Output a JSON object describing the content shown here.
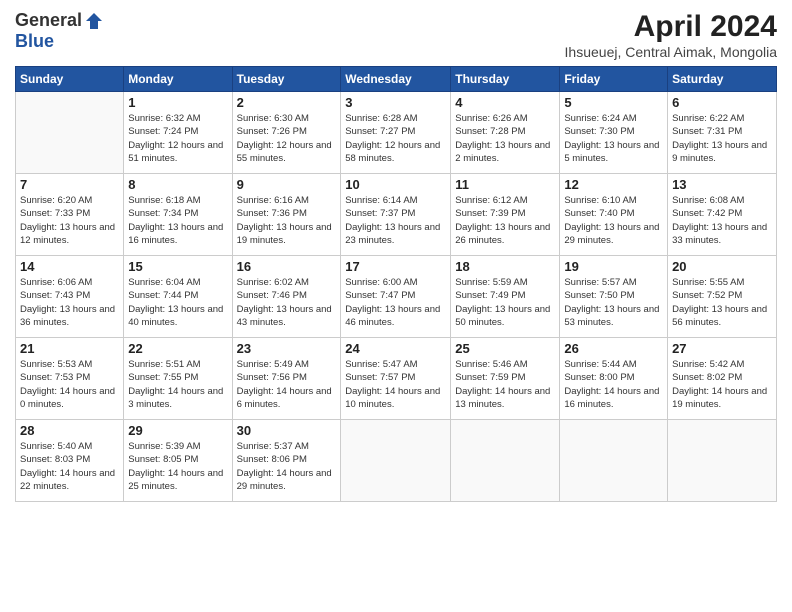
{
  "logo": {
    "general": "General",
    "blue": "Blue"
  },
  "title": "April 2024",
  "location": "Ihsueuej, Central Aimak, Mongolia",
  "headers": [
    "Sunday",
    "Monday",
    "Tuesday",
    "Wednesday",
    "Thursday",
    "Friday",
    "Saturday"
  ],
  "weeks": [
    [
      {
        "day": "",
        "info": ""
      },
      {
        "day": "1",
        "info": "Sunrise: 6:32 AM\nSunset: 7:24 PM\nDaylight: 12 hours\nand 51 minutes."
      },
      {
        "day": "2",
        "info": "Sunrise: 6:30 AM\nSunset: 7:26 PM\nDaylight: 12 hours\nand 55 minutes."
      },
      {
        "day": "3",
        "info": "Sunrise: 6:28 AM\nSunset: 7:27 PM\nDaylight: 12 hours\nand 58 minutes."
      },
      {
        "day": "4",
        "info": "Sunrise: 6:26 AM\nSunset: 7:28 PM\nDaylight: 13 hours\nand 2 minutes."
      },
      {
        "day": "5",
        "info": "Sunrise: 6:24 AM\nSunset: 7:30 PM\nDaylight: 13 hours\nand 5 minutes."
      },
      {
        "day": "6",
        "info": "Sunrise: 6:22 AM\nSunset: 7:31 PM\nDaylight: 13 hours\nand 9 minutes."
      }
    ],
    [
      {
        "day": "7",
        "info": "Sunrise: 6:20 AM\nSunset: 7:33 PM\nDaylight: 13 hours\nand 12 minutes."
      },
      {
        "day": "8",
        "info": "Sunrise: 6:18 AM\nSunset: 7:34 PM\nDaylight: 13 hours\nand 16 minutes."
      },
      {
        "day": "9",
        "info": "Sunrise: 6:16 AM\nSunset: 7:36 PM\nDaylight: 13 hours\nand 19 minutes."
      },
      {
        "day": "10",
        "info": "Sunrise: 6:14 AM\nSunset: 7:37 PM\nDaylight: 13 hours\nand 23 minutes."
      },
      {
        "day": "11",
        "info": "Sunrise: 6:12 AM\nSunset: 7:39 PM\nDaylight: 13 hours\nand 26 minutes."
      },
      {
        "day": "12",
        "info": "Sunrise: 6:10 AM\nSunset: 7:40 PM\nDaylight: 13 hours\nand 29 minutes."
      },
      {
        "day": "13",
        "info": "Sunrise: 6:08 AM\nSunset: 7:42 PM\nDaylight: 13 hours\nand 33 minutes."
      }
    ],
    [
      {
        "day": "14",
        "info": "Sunrise: 6:06 AM\nSunset: 7:43 PM\nDaylight: 13 hours\nand 36 minutes."
      },
      {
        "day": "15",
        "info": "Sunrise: 6:04 AM\nSunset: 7:44 PM\nDaylight: 13 hours\nand 40 minutes."
      },
      {
        "day": "16",
        "info": "Sunrise: 6:02 AM\nSunset: 7:46 PM\nDaylight: 13 hours\nand 43 minutes."
      },
      {
        "day": "17",
        "info": "Sunrise: 6:00 AM\nSunset: 7:47 PM\nDaylight: 13 hours\nand 46 minutes."
      },
      {
        "day": "18",
        "info": "Sunrise: 5:59 AM\nSunset: 7:49 PM\nDaylight: 13 hours\nand 50 minutes."
      },
      {
        "day": "19",
        "info": "Sunrise: 5:57 AM\nSunset: 7:50 PM\nDaylight: 13 hours\nand 53 minutes."
      },
      {
        "day": "20",
        "info": "Sunrise: 5:55 AM\nSunset: 7:52 PM\nDaylight: 13 hours\nand 56 minutes."
      }
    ],
    [
      {
        "day": "21",
        "info": "Sunrise: 5:53 AM\nSunset: 7:53 PM\nDaylight: 14 hours\nand 0 minutes."
      },
      {
        "day": "22",
        "info": "Sunrise: 5:51 AM\nSunset: 7:55 PM\nDaylight: 14 hours\nand 3 minutes."
      },
      {
        "day": "23",
        "info": "Sunrise: 5:49 AM\nSunset: 7:56 PM\nDaylight: 14 hours\nand 6 minutes."
      },
      {
        "day": "24",
        "info": "Sunrise: 5:47 AM\nSunset: 7:57 PM\nDaylight: 14 hours\nand 10 minutes."
      },
      {
        "day": "25",
        "info": "Sunrise: 5:46 AM\nSunset: 7:59 PM\nDaylight: 14 hours\nand 13 minutes."
      },
      {
        "day": "26",
        "info": "Sunrise: 5:44 AM\nSunset: 8:00 PM\nDaylight: 14 hours\nand 16 minutes."
      },
      {
        "day": "27",
        "info": "Sunrise: 5:42 AM\nSunset: 8:02 PM\nDaylight: 14 hours\nand 19 minutes."
      }
    ],
    [
      {
        "day": "28",
        "info": "Sunrise: 5:40 AM\nSunset: 8:03 PM\nDaylight: 14 hours\nand 22 minutes."
      },
      {
        "day": "29",
        "info": "Sunrise: 5:39 AM\nSunset: 8:05 PM\nDaylight: 14 hours\nand 25 minutes."
      },
      {
        "day": "30",
        "info": "Sunrise: 5:37 AM\nSunset: 8:06 PM\nDaylight: 14 hours\nand 29 minutes."
      },
      {
        "day": "",
        "info": ""
      },
      {
        "day": "",
        "info": ""
      },
      {
        "day": "",
        "info": ""
      },
      {
        "day": "",
        "info": ""
      }
    ]
  ]
}
